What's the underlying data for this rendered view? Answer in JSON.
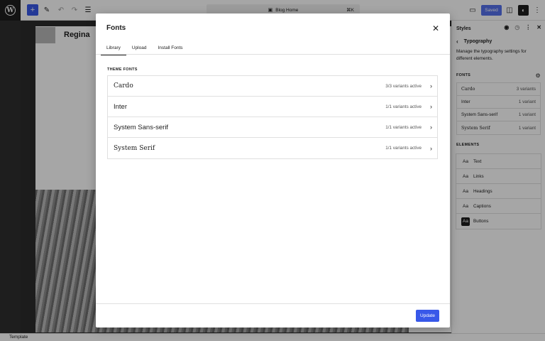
{
  "topbar": {
    "doc_title": "Blog Home",
    "shortcut": "⌘K",
    "saved_label": "Saved"
  },
  "canvas": {
    "site_name": "Regina"
  },
  "sidebar": {
    "title": "Styles",
    "subtitle": "Typography",
    "description": "Manage the typography settings for different elements.",
    "fonts_heading": "Fonts",
    "fonts": [
      {
        "name": "Cardo",
        "variants": "3 variants"
      },
      {
        "name": "Inter",
        "variants": "1 variant"
      },
      {
        "name": "System Sans-serif",
        "variants": "1 variant"
      },
      {
        "name": "System Serif",
        "variants": "1 variant"
      }
    ],
    "elements_heading": "Elements",
    "elements": [
      {
        "icon": "Aa",
        "label": "Text"
      },
      {
        "icon": "Aa",
        "label": "Links"
      },
      {
        "icon": "Aa",
        "label": "Headings"
      },
      {
        "icon": "Aa",
        "label": "Captions"
      },
      {
        "icon": "Aa",
        "label": "Buttons"
      }
    ]
  },
  "footer": {
    "label": "Template"
  },
  "modal": {
    "title": "Fonts",
    "tabs": [
      {
        "label": "Library",
        "active": true
      },
      {
        "label": "Upload",
        "active": false
      },
      {
        "label": "Install Fonts",
        "active": false
      }
    ],
    "theme_fonts_label": "Theme Fonts",
    "fonts": [
      {
        "name": "Cardo",
        "active": "3/3 variants active"
      },
      {
        "name": "Inter",
        "active": "1/1 variants active"
      },
      {
        "name": "System Sans-serif",
        "active": "1/1 variants active"
      },
      {
        "name": "System Serif",
        "active": "1/1 variants active"
      }
    ],
    "update_label": "Update"
  },
  "colors": {
    "accent": "#3858e9",
    "dark": "#1e1e1e"
  }
}
